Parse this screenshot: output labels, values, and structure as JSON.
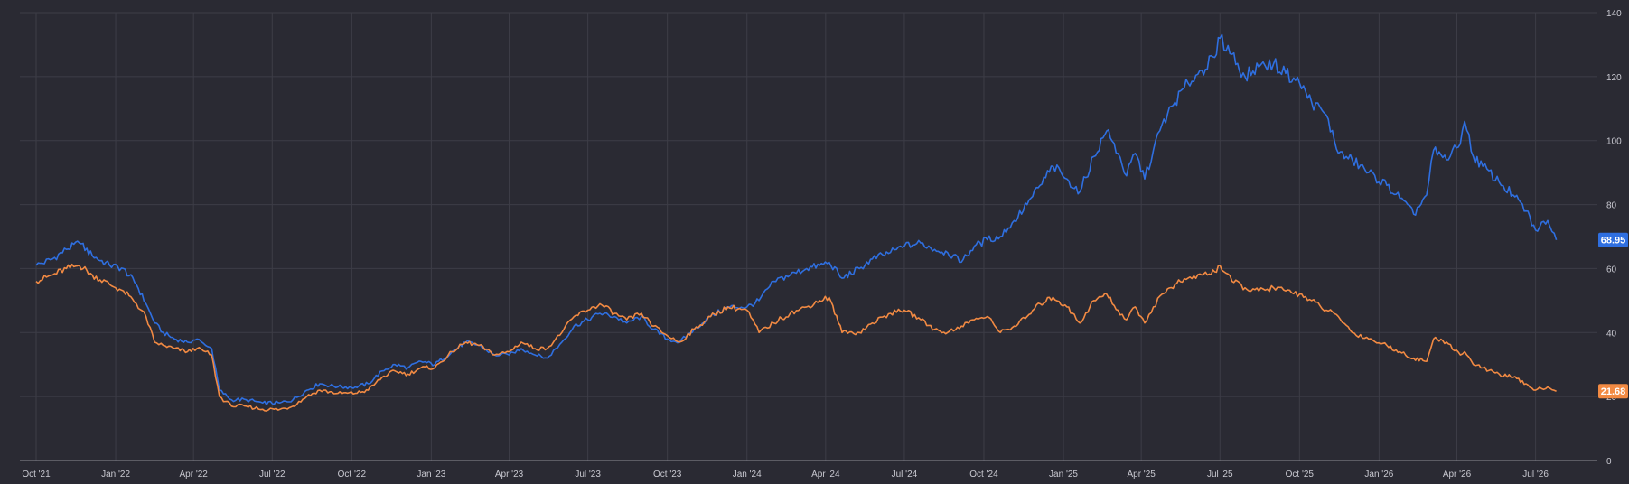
{
  "chart_data": {
    "type": "line",
    "title": "",
    "xlabel": "",
    "ylabel": "",
    "x_range": [
      "2021-10-01",
      "2026-08-01"
    ],
    "ylim": [
      0,
      140
    ],
    "y_ticks": [
      0,
      20,
      40,
      60,
      80,
      100,
      120,
      140
    ],
    "y_axis_position": "right",
    "x_ticks": [
      {
        "date": "2021-10-01",
        "label": "Oct '21"
      },
      {
        "date": "2022-01-01",
        "label": "Jan '22"
      },
      {
        "date": "2022-04-01",
        "label": "Apr '22"
      },
      {
        "date": "2022-07-01",
        "label": "Jul '22"
      },
      {
        "date": "2022-10-01",
        "label": "Oct '22"
      },
      {
        "date": "2023-01-01",
        "label": "Jan '23"
      },
      {
        "date": "2023-04-01",
        "label": "Apr '23"
      },
      {
        "date": "2023-07-01",
        "label": "Jul '23"
      },
      {
        "date": "2023-10-01",
        "label": "Oct '23"
      },
      {
        "date": "2024-01-01",
        "label": "Jan '24"
      },
      {
        "date": "2024-04-01",
        "label": "Apr '24"
      },
      {
        "date": "2024-07-01",
        "label": "Jul '24"
      },
      {
        "date": "2024-10-01",
        "label": "Oct '24"
      },
      {
        "date": "2025-01-01",
        "label": "Jan '25"
      },
      {
        "date": "2025-04-01",
        "label": "Apr '25"
      },
      {
        "date": "2025-07-01",
        "label": "Jul '25"
      },
      {
        "date": "2025-10-01",
        "label": "Oct '25"
      },
      {
        "date": "2026-01-01",
        "label": "Jan '26"
      },
      {
        "date": "2026-04-01",
        "label": "Apr '26"
      },
      {
        "date": "2026-07-01",
        "label": "Jul '26"
      }
    ],
    "grid": true,
    "legend": "none",
    "colors": {
      "background": "#2a2a33",
      "grid": "#3d3d47",
      "axis": "#8d8d96",
      "tick_text": "#c9c9d1"
    },
    "series": [
      {
        "color": "#2f6fe0",
        "last_value": 68.95,
        "last_label": "68.95",
        "points": [
          [
            "2021-10-01",
            61
          ],
          [
            "2021-10-20",
            63
          ],
          [
            "2021-11-05",
            66
          ],
          [
            "2021-11-20",
            68
          ],
          [
            "2021-12-05",
            64
          ],
          [
            "2021-12-25",
            61
          ],
          [
            "2022-01-10",
            60
          ],
          [
            "2022-01-25",
            55
          ],
          [
            "2022-02-05",
            49
          ],
          [
            "2022-02-15",
            43
          ],
          [
            "2022-02-25",
            40
          ],
          [
            "2022-03-10",
            38
          ],
          [
            "2022-03-25",
            37
          ],
          [
            "2022-04-05",
            38
          ],
          [
            "2022-04-15",
            36
          ],
          [
            "2022-04-22",
            35
          ],
          [
            "2022-05-01",
            22
          ],
          [
            "2022-05-15",
            19
          ],
          [
            "2022-06-01",
            19
          ],
          [
            "2022-06-20",
            18
          ],
          [
            "2022-07-10",
            18
          ],
          [
            "2022-07-25",
            19
          ],
          [
            "2022-08-10",
            22
          ],
          [
            "2022-08-25",
            24
          ],
          [
            "2022-09-15",
            23
          ],
          [
            "2022-10-05",
            23
          ],
          [
            "2022-10-20",
            24
          ],
          [
            "2022-11-05",
            28
          ],
          [
            "2022-11-20",
            30
          ],
          [
            "2022-12-05",
            29
          ],
          [
            "2022-12-20",
            31
          ],
          [
            "2023-01-05",
            30
          ],
          [
            "2023-01-25",
            34
          ],
          [
            "2023-02-10",
            37
          ],
          [
            "2023-02-25",
            36
          ],
          [
            "2023-03-15",
            33
          ],
          [
            "2023-04-01",
            33
          ],
          [
            "2023-04-15",
            35
          ],
          [
            "2023-05-01",
            33
          ],
          [
            "2023-05-15",
            32
          ],
          [
            "2023-06-01",
            37
          ],
          [
            "2023-06-15",
            42
          ],
          [
            "2023-07-01",
            44
          ],
          [
            "2023-07-15",
            46
          ],
          [
            "2023-08-01",
            45
          ],
          [
            "2023-08-15",
            43
          ],
          [
            "2023-09-01",
            45
          ],
          [
            "2023-09-15",
            41
          ],
          [
            "2023-10-01",
            38
          ],
          [
            "2023-10-15",
            37
          ],
          [
            "2023-11-01",
            41
          ],
          [
            "2023-11-20",
            45
          ],
          [
            "2023-12-10",
            48
          ],
          [
            "2024-01-01",
            48
          ],
          [
            "2024-01-15",
            50
          ],
          [
            "2024-02-01",
            56
          ],
          [
            "2024-02-20",
            58
          ],
          [
            "2024-03-10",
            60
          ],
          [
            "2024-03-25",
            61
          ],
          [
            "2024-04-05",
            62
          ],
          [
            "2024-04-20",
            57
          ],
          [
            "2024-05-10",
            60
          ],
          [
            "2024-05-25",
            63
          ],
          [
            "2024-06-15",
            65
          ],
          [
            "2024-07-01",
            67
          ],
          [
            "2024-07-20",
            68
          ],
          [
            "2024-08-05",
            66
          ],
          [
            "2024-08-20",
            65
          ],
          [
            "2024-09-05",
            62
          ],
          [
            "2024-09-20",
            67
          ],
          [
            "2024-10-05",
            69
          ],
          [
            "2024-10-20",
            70
          ],
          [
            "2024-11-05",
            75
          ],
          [
            "2024-11-20",
            80
          ],
          [
            "2024-12-05",
            86
          ],
          [
            "2024-12-20",
            92
          ],
          [
            "2025-01-05",
            88
          ],
          [
            "2025-01-20",
            84
          ],
          [
            "2025-02-05",
            95
          ],
          [
            "2025-02-20",
            103
          ],
          [
            "2025-03-05",
            96
          ],
          [
            "2025-03-15",
            89
          ],
          [
            "2025-03-25",
            96
          ],
          [
            "2025-04-05",
            88
          ],
          [
            "2025-04-15",
            97
          ],
          [
            "2025-04-25",
            105
          ],
          [
            "2025-05-10",
            112
          ],
          [
            "2025-05-25",
            118
          ],
          [
            "2025-06-10",
            122
          ],
          [
            "2025-06-25",
            126
          ],
          [
            "2025-07-01",
            132
          ],
          [
            "2025-07-15",
            127
          ],
          [
            "2025-07-30",
            120
          ],
          [
            "2025-08-15",
            123
          ],
          [
            "2025-09-01",
            124
          ],
          [
            "2025-09-15",
            121
          ],
          [
            "2025-10-01",
            118
          ],
          [
            "2025-10-15",
            112
          ],
          [
            "2025-11-01",
            108
          ],
          [
            "2025-11-15",
            96
          ],
          [
            "2025-12-01",
            94
          ],
          [
            "2025-12-20",
            90
          ],
          [
            "2026-01-10",
            86
          ],
          [
            "2026-01-25",
            82
          ],
          [
            "2026-02-10",
            77
          ],
          [
            "2026-02-25",
            83
          ],
          [
            "2026-03-05",
            97
          ],
          [
            "2026-03-20",
            94
          ],
          [
            "2026-04-05",
            99
          ],
          [
            "2026-04-10",
            106
          ],
          [
            "2026-04-20",
            95
          ],
          [
            "2026-05-01",
            92
          ],
          [
            "2026-05-20",
            87
          ],
          [
            "2026-06-05",
            83
          ],
          [
            "2026-06-20",
            78
          ],
          [
            "2026-07-01",
            72
          ],
          [
            "2026-07-15",
            75
          ],
          [
            "2026-07-25",
            68.95
          ]
        ]
      },
      {
        "color": "#f28a43",
        "last_value": 21.68,
        "last_label": "21.68",
        "points": [
          [
            "2021-10-01",
            56
          ],
          [
            "2021-10-20",
            58
          ],
          [
            "2021-11-05",
            60
          ],
          [
            "2021-11-20",
            61
          ],
          [
            "2021-12-05",
            58
          ],
          [
            "2021-12-25",
            55
          ],
          [
            "2022-01-10",
            53
          ],
          [
            "2022-01-25",
            49
          ],
          [
            "2022-02-05",
            45
          ],
          [
            "2022-02-15",
            37
          ],
          [
            "2022-02-25",
            36
          ],
          [
            "2022-03-10",
            35
          ],
          [
            "2022-03-25",
            34
          ],
          [
            "2022-04-05",
            35
          ],
          [
            "2022-04-15",
            34
          ],
          [
            "2022-04-22",
            33
          ],
          [
            "2022-05-01",
            20
          ],
          [
            "2022-05-15",
            17
          ],
          [
            "2022-06-01",
            17
          ],
          [
            "2022-06-20",
            16
          ],
          [
            "2022-07-10",
            16
          ],
          [
            "2022-07-25",
            17
          ],
          [
            "2022-08-10",
            20
          ],
          [
            "2022-08-25",
            22
          ],
          [
            "2022-09-15",
            21
          ],
          [
            "2022-10-05",
            21
          ],
          [
            "2022-10-20",
            22
          ],
          [
            "2022-11-05",
            26
          ],
          [
            "2022-11-20",
            28
          ],
          [
            "2022-12-05",
            27
          ],
          [
            "2022-12-20",
            29
          ],
          [
            "2023-01-05",
            29
          ],
          [
            "2023-01-25",
            34
          ],
          [
            "2023-02-10",
            37
          ],
          [
            "2023-02-25",
            36
          ],
          [
            "2023-03-15",
            33
          ],
          [
            "2023-04-01",
            34
          ],
          [
            "2023-04-15",
            37
          ],
          [
            "2023-05-01",
            35
          ],
          [
            "2023-05-15",
            35
          ],
          [
            "2023-06-01",
            40
          ],
          [
            "2023-06-15",
            45
          ],
          [
            "2023-07-01",
            47
          ],
          [
            "2023-07-15",
            49
          ],
          [
            "2023-08-01",
            46
          ],
          [
            "2023-08-15",
            44
          ],
          [
            "2023-09-01",
            46
          ],
          [
            "2023-09-15",
            42
          ],
          [
            "2023-10-01",
            39
          ],
          [
            "2023-10-15",
            37
          ],
          [
            "2023-11-01",
            41
          ],
          [
            "2023-11-20",
            45
          ],
          [
            "2023-12-10",
            48
          ],
          [
            "2024-01-01",
            47
          ],
          [
            "2024-01-15",
            40
          ],
          [
            "2024-02-01",
            43
          ],
          [
            "2024-02-20",
            46
          ],
          [
            "2024-03-10",
            48
          ],
          [
            "2024-03-25",
            50
          ],
          [
            "2024-04-05",
            51
          ],
          [
            "2024-04-20",
            40
          ],
          [
            "2024-05-10",
            40
          ],
          [
            "2024-05-25",
            43
          ],
          [
            "2024-06-15",
            46
          ],
          [
            "2024-07-01",
            47
          ],
          [
            "2024-07-20",
            44
          ],
          [
            "2024-08-05",
            41
          ],
          [
            "2024-08-20",
            40
          ],
          [
            "2024-09-05",
            42
          ],
          [
            "2024-09-20",
            44
          ],
          [
            "2024-10-05",
            45
          ],
          [
            "2024-10-20",
            40
          ],
          [
            "2024-11-05",
            42
          ],
          [
            "2024-11-20",
            45
          ],
          [
            "2024-12-05",
            49
          ],
          [
            "2024-12-20",
            51
          ],
          [
            "2025-01-05",
            48
          ],
          [
            "2025-01-20",
            43
          ],
          [
            "2025-02-05",
            50
          ],
          [
            "2025-02-20",
            52
          ],
          [
            "2025-03-05",
            47
          ],
          [
            "2025-03-15",
            44
          ],
          [
            "2025-03-25",
            48
          ],
          [
            "2025-04-05",
            43
          ],
          [
            "2025-04-15",
            48
          ],
          [
            "2025-04-25",
            52
          ],
          [
            "2025-05-10",
            55
          ],
          [
            "2025-05-25",
            57
          ],
          [
            "2025-06-10",
            58
          ],
          [
            "2025-06-25",
            59
          ],
          [
            "2025-07-01",
            61
          ],
          [
            "2025-07-15",
            56
          ],
          [
            "2025-07-30",
            54
          ],
          [
            "2025-08-15",
            53
          ],
          [
            "2025-09-01",
            54
          ],
          [
            "2025-09-15",
            53
          ],
          [
            "2025-10-01",
            52
          ],
          [
            "2025-10-15",
            50
          ],
          [
            "2025-11-01",
            47
          ],
          [
            "2025-11-15",
            45
          ],
          [
            "2025-12-01",
            40
          ],
          [
            "2025-12-20",
            38
          ],
          [
            "2026-01-10",
            36
          ],
          [
            "2026-01-25",
            34
          ],
          [
            "2026-02-10",
            32
          ],
          [
            "2026-02-25",
            31
          ],
          [
            "2026-03-05",
            38
          ],
          [
            "2026-03-20",
            37
          ],
          [
            "2026-04-05",
            33
          ],
          [
            "2026-04-10",
            34
          ],
          [
            "2026-04-20",
            30
          ],
          [
            "2026-05-01",
            29
          ],
          [
            "2026-05-20",
            27
          ],
          [
            "2026-06-05",
            26
          ],
          [
            "2026-06-20",
            24
          ],
          [
            "2026-07-01",
            22
          ],
          [
            "2026-07-15",
            23
          ],
          [
            "2026-07-25",
            21.68
          ]
        ]
      }
    ]
  }
}
